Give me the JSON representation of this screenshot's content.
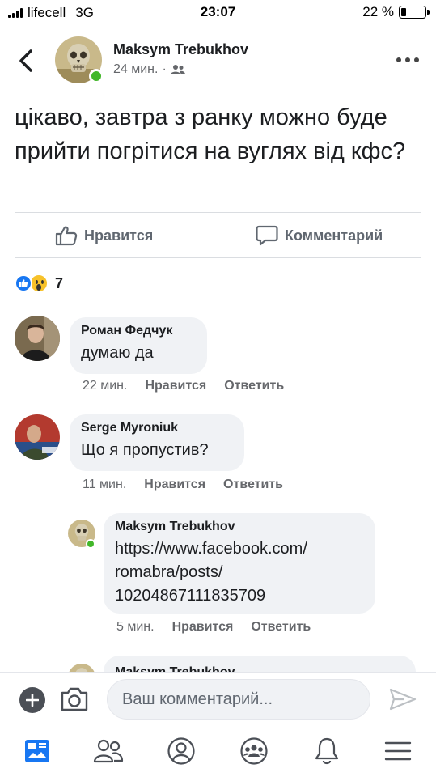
{
  "status": {
    "carrier": "lifecell",
    "network": "3G",
    "time": "23:07",
    "battery": "22 %",
    "battery_level": 0.22
  },
  "post": {
    "author": "Maksym Trebukhov",
    "time": "24 мин.",
    "separator": "·",
    "audience_icon": "friends-icon",
    "text": "цікаво, завтра з ранку можно буде прийти погрітися на вуглях від кфс?",
    "actions": {
      "like": "Нравится",
      "comment": "Комментарий"
    },
    "reactions": {
      "types": [
        "like",
        "wow"
      ],
      "count": "7"
    }
  },
  "comments": [
    {
      "author": "Роман Федчук",
      "text": "думаю да",
      "time": "22 мин.",
      "like": "Нравится",
      "reply": "Ответить"
    },
    {
      "author": "Serge Myroniuk",
      "text": "Що я пропустив?",
      "time": "11 мин.",
      "like": "Нравится",
      "reply": "Ответить",
      "replies": [
        {
          "author": "Maksym Trebukhov",
          "text": "https://www.facebook.com/romabra/posts/10204867111835709",
          "text_lines": [
            "https://www.facebook.com/",
            "romabra/posts/",
            "10204867111835709"
          ],
          "time": "5 мин.",
          "like": "Нравится",
          "reply": "Ответить"
        },
        {
          "author": "Maksym Trebukhov"
        }
      ]
    }
  ],
  "composer": {
    "placeholder": "Ваш комментарий..."
  },
  "colors": {
    "brand": "#1877f2",
    "online": "#42b72a",
    "bubble": "#f0f2f5",
    "meta": "#65676b"
  },
  "tabs": [
    "news-feed-icon",
    "friends-icon",
    "profile-icon",
    "groups-icon",
    "notifications-icon",
    "menu-icon"
  ]
}
